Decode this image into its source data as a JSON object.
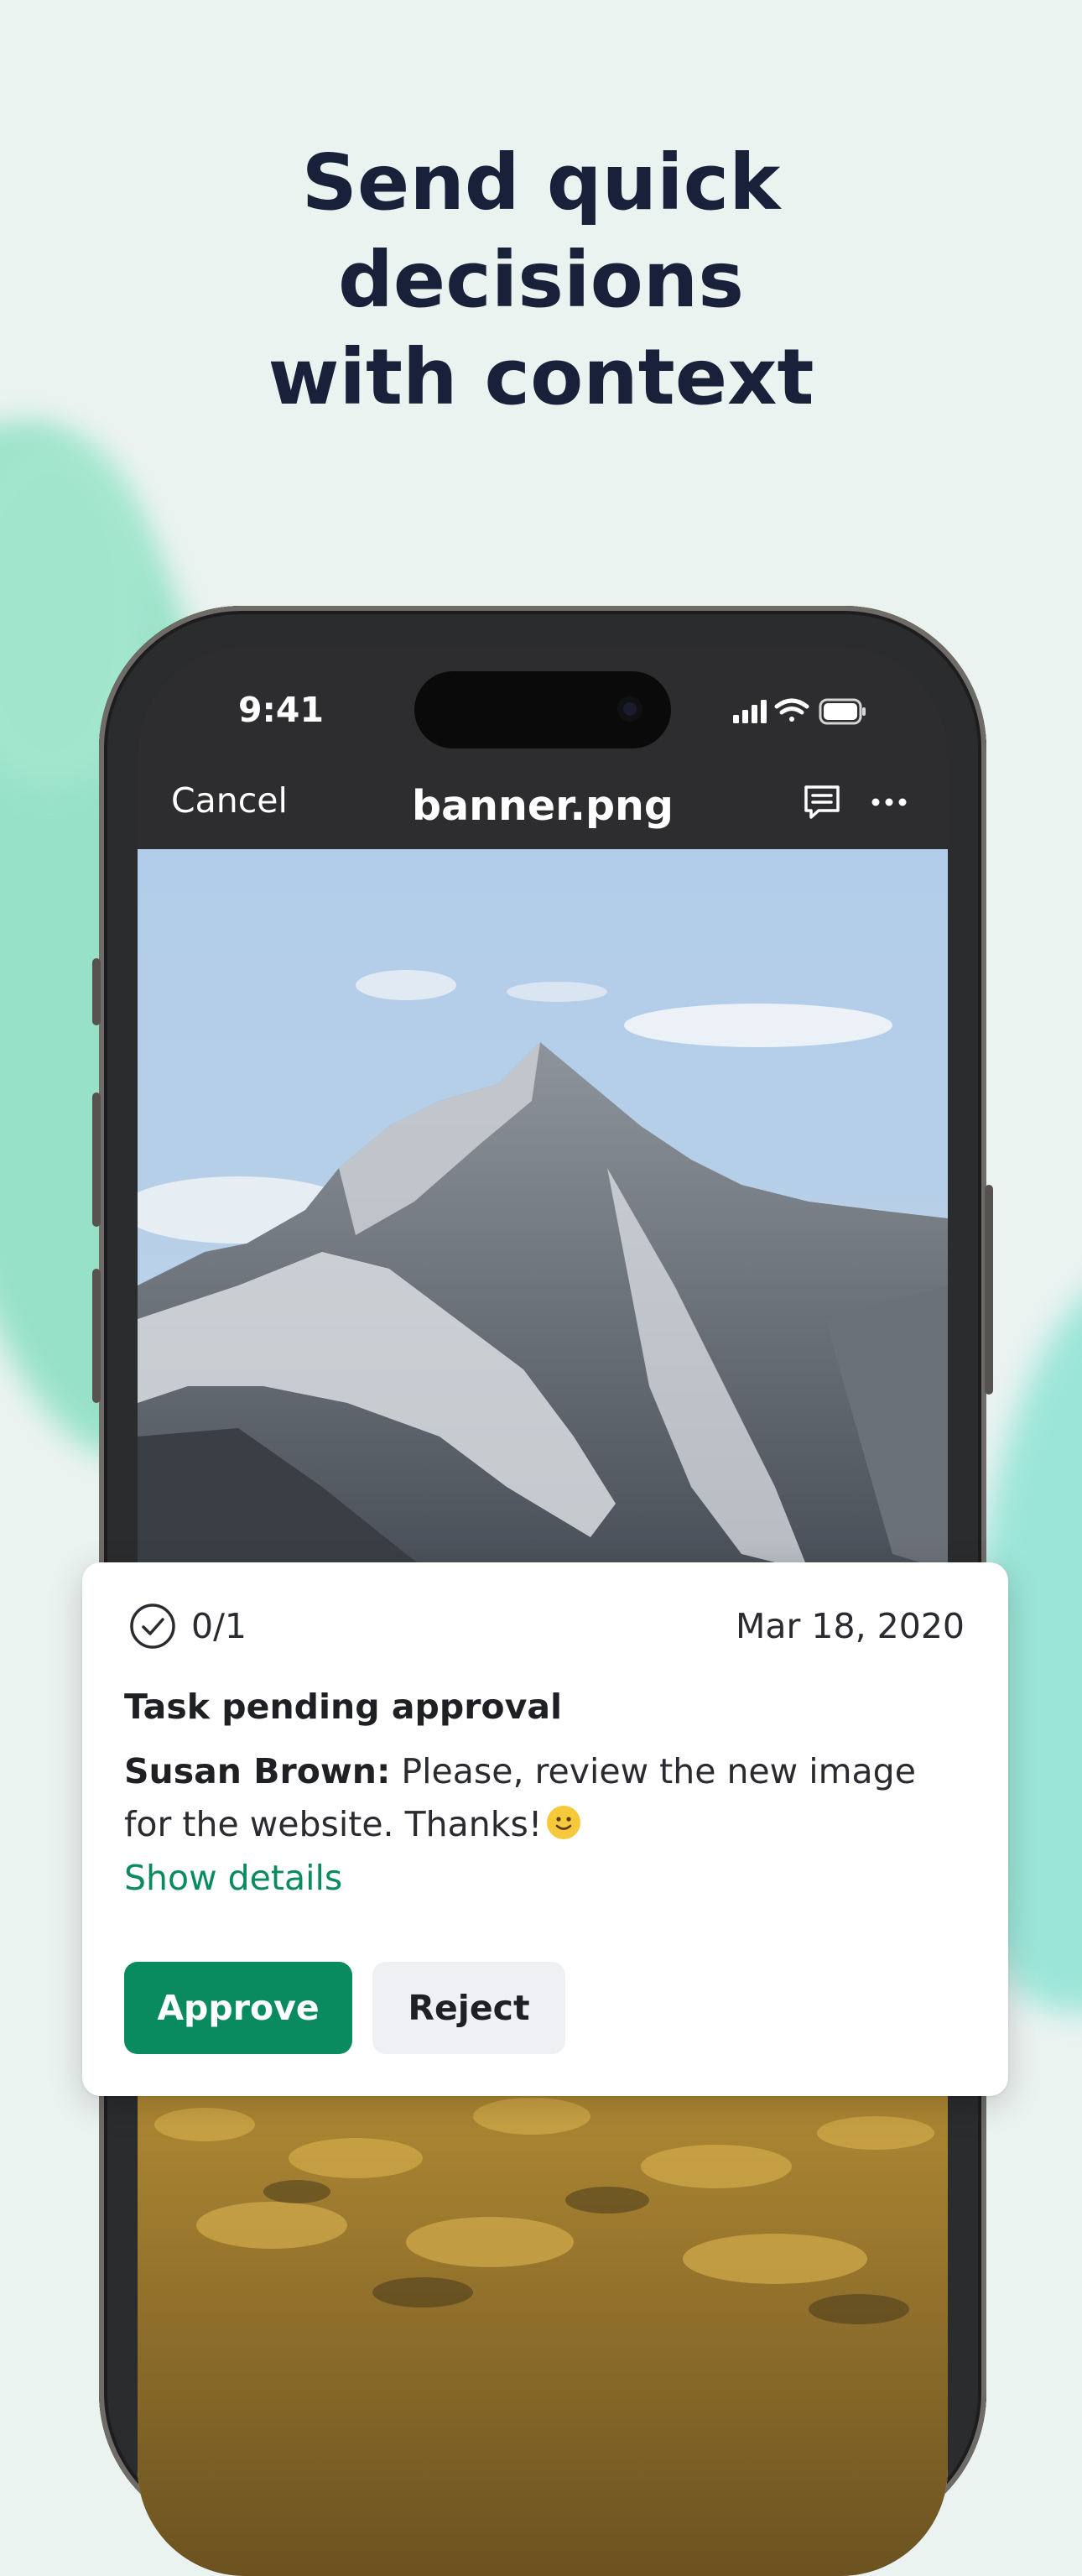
{
  "headline": "Send quick decisions with context",
  "status_bar": {
    "time": "9:41",
    "icons": [
      "signal-icon",
      "wifi-icon",
      "battery-icon"
    ]
  },
  "nav": {
    "cancel": "Cancel",
    "title": "banner.png",
    "icons": [
      "comment-icon",
      "more-icon"
    ]
  },
  "photo": {
    "subject": "mountain-photo"
  },
  "task_card": {
    "progress": "0/1",
    "date": "Mar 18, 2020",
    "title": "Task pending approval",
    "author": "Susan Brown:",
    "message": " Please, review the new image for the website. Thanks!",
    "details_link": "Show details",
    "approve": "Approve",
    "reject": "Reject"
  },
  "colors": {
    "background": "#ebf3f1",
    "headline": "#18203a",
    "accent": "#0a8a5f",
    "splash": "#8fe0c4"
  }
}
